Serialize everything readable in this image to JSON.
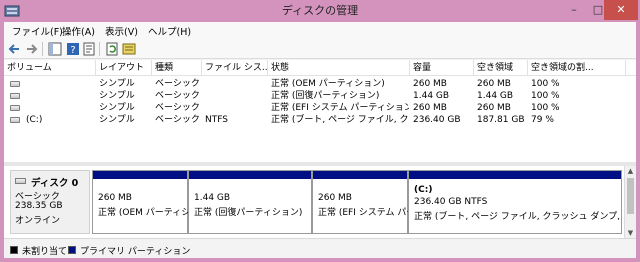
{
  "window": {
    "title": "ディスクの管理",
    "minimize": "–",
    "maximize": "□",
    "close": "✕"
  },
  "menu": [
    "ファイル(F)",
    "操作(A)",
    "表示(V)",
    "ヘルプ(H)"
  ],
  "toolbar": [
    "back-arrow-icon",
    "forward-arrow-icon",
    "console-tree-icon",
    "help-icon",
    "properties-icon",
    "refresh-icon",
    "rescan-icon"
  ],
  "table": {
    "columns": [
      "ボリューム",
      "レイアウト",
      "種類",
      "ファイル シス...",
      "状態",
      "容量",
      "空き領域",
      "空き領域の割..."
    ],
    "rows": [
      [
        "",
        "シンプル",
        "ベーシック",
        "",
        "正常 (OEM パーティション)",
        "260 MB",
        "260 MB",
        "100 %"
      ],
      [
        "",
        "シンプル",
        "ベーシック",
        "",
        "正常 (回復パーティション)",
        "1.44 GB",
        "1.44 GB",
        "100 %"
      ],
      [
        "",
        "シンプル",
        "ベーシック",
        "",
        "正常 (EFI システム パーティション)",
        "260 MB",
        "260 MB",
        "100 %"
      ],
      [
        "(C:)",
        "シンプル",
        "ベーシック",
        "NTFS",
        "正常 (ブート, ページ ファイル, クラッ...",
        "236.40 GB",
        "187.81 GB",
        "79 %"
      ]
    ]
  },
  "disk": {
    "name": "ディスク 0",
    "type": "ベーシック",
    "size": "238.35 GB",
    "status": "オンライン"
  },
  "partitions": [
    {
      "title": "",
      "size": "260 MB",
      "status": "正常 (OEM パーティション)"
    },
    {
      "title": "",
      "size": "1.44 GB",
      "status": "正常 (回復パーティション)"
    },
    {
      "title": "",
      "size": "260 MB",
      "status": "正常 (EFI システム パーティション)"
    },
    {
      "title": "(C:)",
      "size": "236.40 GB NTFS",
      "status": "正常 (ブート, ページ ファイル, クラッシュ ダンプ, プライマリ パ"
    }
  ],
  "legend": {
    "unallocated": "未割り当て",
    "primary": "プライマリ パーティション"
  },
  "colors": {
    "titlebar": "#d393bd",
    "close": "#c7504c",
    "partition_bar": "#000f84",
    "unallocated": "#000000"
  }
}
